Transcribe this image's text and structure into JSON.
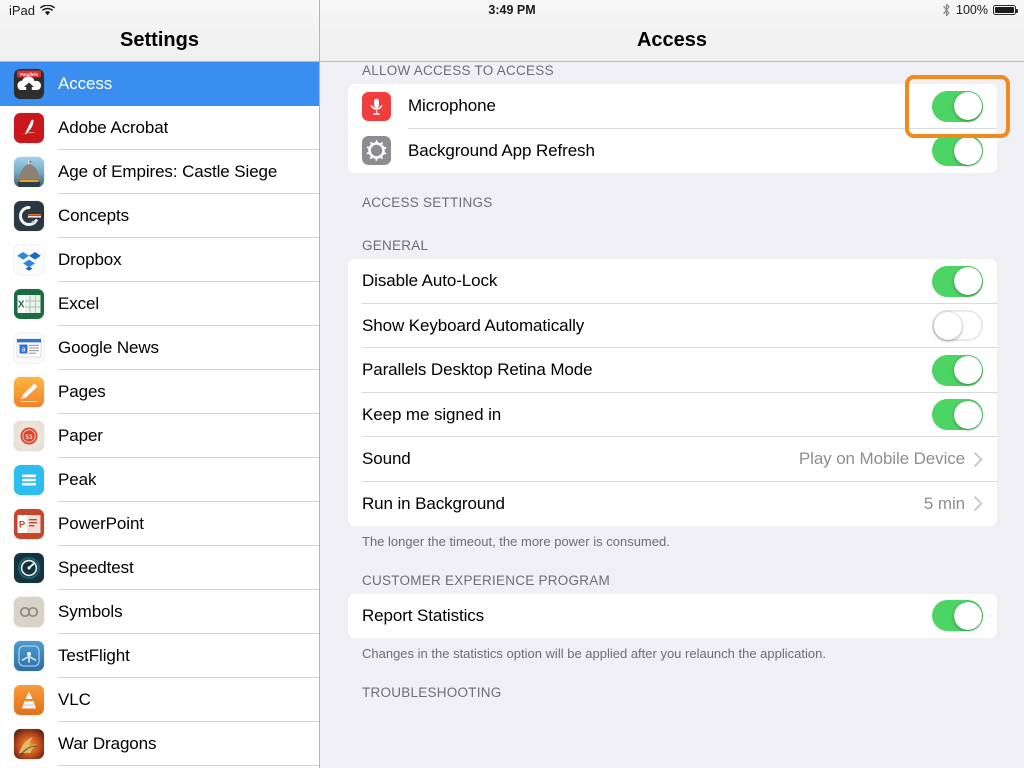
{
  "status_bar": {
    "device": "iPad",
    "wifi_icon": "wifi-icon",
    "time": "3:49 PM",
    "bluetooth_icon": "bluetooth-icon",
    "battery_percent": "100%",
    "battery_icon": "battery-full-icon"
  },
  "sidebar": {
    "title": "Settings",
    "items": [
      {
        "label": "Access",
        "icon": "parallels-access-app-icon",
        "selected": true
      },
      {
        "label": "Adobe Acrobat",
        "icon": "adobe-acrobat-app-icon",
        "selected": false
      },
      {
        "label": "Age of Empires: Castle Siege",
        "icon": "age-of-empires-app-icon",
        "selected": false
      },
      {
        "label": "Concepts",
        "icon": "concepts-app-icon",
        "selected": false
      },
      {
        "label": "Dropbox",
        "icon": "dropbox-app-icon",
        "selected": false
      },
      {
        "label": "Excel",
        "icon": "excel-app-icon",
        "selected": false
      },
      {
        "label": "Google News",
        "icon": "google-news-app-icon",
        "selected": false
      },
      {
        "label": "Pages",
        "icon": "pages-app-icon",
        "selected": false
      },
      {
        "label": "Paper",
        "icon": "paper-app-icon",
        "selected": false
      },
      {
        "label": "Peak",
        "icon": "peak-app-icon",
        "selected": false
      },
      {
        "label": "PowerPoint",
        "icon": "powerpoint-app-icon",
        "selected": false
      },
      {
        "label": "Speedtest",
        "icon": "speedtest-app-icon",
        "selected": false
      },
      {
        "label": "Symbols",
        "icon": "symbols-app-icon",
        "selected": false
      },
      {
        "label": "TestFlight",
        "icon": "testflight-app-icon",
        "selected": false
      },
      {
        "label": "VLC",
        "icon": "vlc-app-icon",
        "selected": false
      },
      {
        "label": "War Dragons",
        "icon": "war-dragons-app-icon",
        "selected": false
      }
    ]
  },
  "main": {
    "title": "Access",
    "sections": [
      {
        "header": "ALLOW ACCESS TO ACCESS",
        "rows": [
          {
            "label": "Microphone",
            "icon": "microphone-icon",
            "control": "switch",
            "value": "on",
            "highlighted": true
          },
          {
            "label": "Background App Refresh",
            "icon": "gear-icon",
            "control": "switch",
            "value": "on",
            "highlighted": false
          }
        ]
      },
      {
        "header": "ACCESS SETTINGS",
        "rows": []
      },
      {
        "header": "GENERAL",
        "rows": [
          {
            "label": "Disable Auto-Lock",
            "control": "switch",
            "value": "on"
          },
          {
            "label": "Show Keyboard Automatically",
            "control": "switch",
            "value": "off"
          },
          {
            "label": "Parallels Desktop Retina Mode",
            "control": "switch",
            "value": "on"
          },
          {
            "label": "Keep me signed in",
            "control": "switch",
            "value": "on"
          },
          {
            "label": "Sound",
            "control": "disclosure",
            "value": "Play on Mobile Device"
          },
          {
            "label": "Run in Background",
            "control": "disclosure",
            "value": "5 min"
          }
        ],
        "footnote": "The longer the timeout, the more power is consumed."
      },
      {
        "header": "CUSTOMER EXPERIENCE PROGRAM",
        "rows": [
          {
            "label": "Report Statistics",
            "control": "switch",
            "value": "on"
          }
        ],
        "footnote": "Changes in the statistics option will be applied after you relaunch the application."
      },
      {
        "header": "TROUBLESHOOTING",
        "rows": []
      }
    ]
  },
  "colors": {
    "selection_blue": "#3A8EF0",
    "switch_on_green": "#4CD464",
    "highlight_orange": "#F08A1E",
    "background": "#EFEFF4",
    "secondary_text": "#6D6D72"
  }
}
